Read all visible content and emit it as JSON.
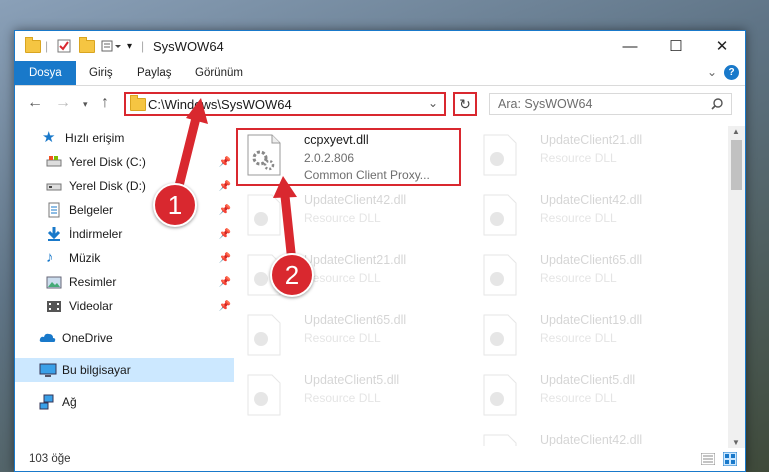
{
  "window": {
    "title": "SysWOW64",
    "controls": {
      "minimize": "—",
      "maximize": "☐",
      "close": "✕"
    }
  },
  "ribbon": {
    "tabs": [
      "Dosya",
      "Giriş",
      "Paylaş",
      "Görünüm"
    ],
    "active_tab": "Dosya"
  },
  "address_bar": {
    "path": "C:\\Windows\\SysWOW64"
  },
  "search": {
    "placeholder": "Ara: SysWOW64"
  },
  "sidebar": {
    "quick_access_label": "Hızlı erişim",
    "items": [
      {
        "label": "Yerel Disk (C:)",
        "icon": "drive-icon",
        "pinned": true
      },
      {
        "label": "Yerel Disk (D:)",
        "icon": "drive-icon",
        "pinned": true
      },
      {
        "label": "Belgeler",
        "icon": "documents-icon",
        "pinned": true
      },
      {
        "label": "İndirmeler",
        "icon": "downloads-icon",
        "pinned": true
      },
      {
        "label": "Müzik",
        "icon": "music-icon",
        "pinned": true
      },
      {
        "label": "Resimler",
        "icon": "pictures-icon",
        "pinned": true
      },
      {
        "label": "Videolar",
        "icon": "videos-icon",
        "pinned": true
      }
    ],
    "onedrive": "OneDrive",
    "this_pc": "Bu bilgisayar",
    "network": "Ağ"
  },
  "files": {
    "highlighted": {
      "name": "ccpxyevt.dll",
      "version": "2.0.2.806",
      "description": "Common Client Proxy..."
    },
    "faded_col1": [
      {
        "name": "UpdateClient42.dll",
        "type": "Resource DLL"
      },
      {
        "name": "UpdateClient21.dll",
        "type": "Resource DLL"
      },
      {
        "name": "UpdateClient65.dll",
        "type": "Resource DLL"
      },
      {
        "name": "UpdateClient5.dll",
        "type": "Resource DLL"
      }
    ],
    "faded_col2": [
      {
        "name": "UpdateClient21.dll",
        "type": "Resource DLL"
      },
      {
        "name": "UpdateClient42.dll",
        "type": "Resource DLL"
      },
      {
        "name": "UpdateClient65.dll",
        "type": "Resource DLL"
      },
      {
        "name": "UpdateClient19.dll",
        "type": "Resource DLL"
      },
      {
        "name": "UpdateClient5.dll",
        "type": "Resource DLL"
      },
      {
        "name": "UpdateClient42.dll",
        "type": "Resource DLL"
      }
    ]
  },
  "status": {
    "item_count": "103 öğe"
  },
  "annotations": {
    "step1": "1",
    "step2": "2",
    "color": "#d9282f"
  }
}
